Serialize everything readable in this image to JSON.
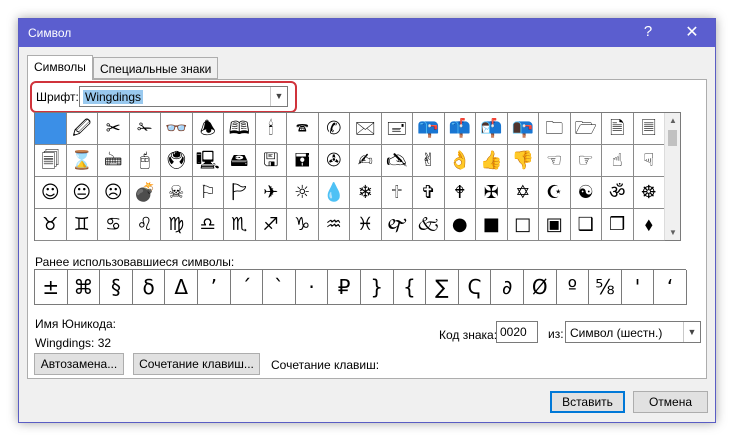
{
  "window": {
    "title": "Символ",
    "help_label": "?",
    "close_label": "✕"
  },
  "tabs": [
    {
      "label": "Символы",
      "active": true
    },
    {
      "label": "Специальные знаки",
      "active": false
    }
  ],
  "font": {
    "label": "Шрифт:",
    "value": "Wingdings"
  },
  "symbol_grid": {
    "rows": [
      [
        " ",
        "🖉",
        "✂",
        "✁",
        "👓",
        "🕭",
        "🕮",
        "🕯",
        "🕿",
        "✆",
        "🖂",
        "🖃",
        "📪",
        "📫",
        "📬",
        "📭",
        "🗀",
        "🗁",
        "🗎",
        "🗏"
      ],
      [
        "🗐",
        "⌛",
        "🖮",
        "🖰",
        "🖲",
        "🖳",
        "🖴",
        "🖫",
        "🖬",
        "✇",
        "✍",
        "🖎",
        "✌",
        "👌",
        "👍",
        "👎",
        "☜",
        "☞",
        "☝",
        "☟"
      ],
      [
        "☺",
        "😐",
        "☹",
        "💣",
        "☠",
        "⚐",
        "🏱",
        "✈",
        "☼",
        "💧",
        "❄",
        "🕆",
        "✞",
        "🕈",
        "✠",
        "✡",
        "☪",
        "☯",
        "ॐ",
        "☸"
      ],
      [
        "♉",
        "♊",
        "♋",
        "♌",
        "♍",
        "♎",
        "♏",
        "♐",
        "♑",
        "♒",
        "♓",
        "🙰",
        "🙵",
        "●",
        "■",
        "□",
        "▣",
        "❑",
        "❒",
        "⬧"
      ]
    ]
  },
  "recent": {
    "label": "Ранее использовавшиеся символы:",
    "symbols": [
      "±",
      "⌘",
      "§",
      "δ",
      "Δ",
      "’",
      "´",
      "`",
      "·",
      "₽",
      "}",
      "{",
      "∑",
      "Ҁ",
      "∂",
      "Ø",
      "º",
      "⅝",
      "'",
      "‘",
      "✓"
    ]
  },
  "unicode": {
    "name_label": "Имя Юникода:",
    "info": "Wingdings: 32"
  },
  "code": {
    "label": "Код знака:",
    "value": "0020",
    "from_label": "из:",
    "from_value": "Символ (шестн.)"
  },
  "buttons": {
    "autocorrect": "Автозамена...",
    "shortcut_key": "Сочетание клавиш...",
    "shortcut_label": "Сочетание клавиш:",
    "insert": "Вставить",
    "cancel": "Отмена"
  }
}
